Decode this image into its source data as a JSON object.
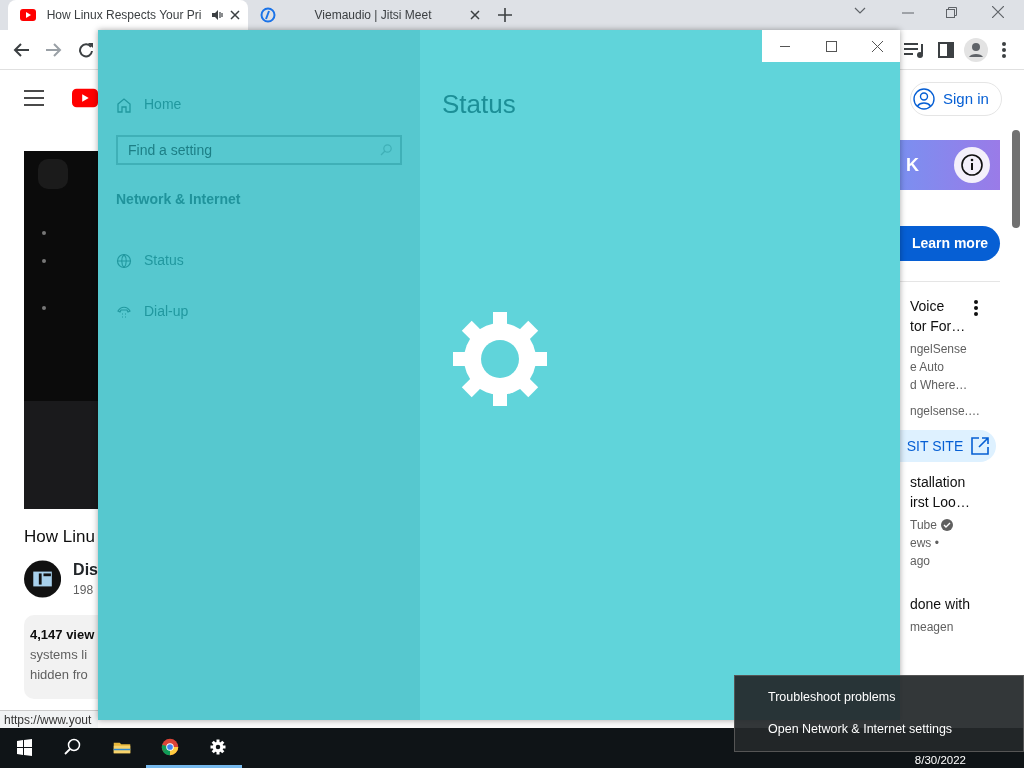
{
  "browser": {
    "tabs": [
      {
        "title": "How Linux Respects Your Pri",
        "selected": true,
        "audio": true
      },
      {
        "title": "Viemaudio | Jitsi Meet",
        "selected": false,
        "audio": false
      }
    ],
    "sign_in": "Sign in",
    "video_title": "How Linu",
    "channel_name": "Dis",
    "subscribers": "198",
    "description": [
      "4,147 view",
      "systems li",
      "hidden fro"
    ],
    "status_url": "https://www.yout",
    "ad": {
      "title": "K",
      "button": "Learn more"
    },
    "side_items": [
      {
        "title_lines": [
          "Voice",
          "tor For…"
        ],
        "meta": [
          "ngelSense",
          "e Auto",
          "d Where…"
        ],
        "link": "ngelsense.…",
        "site_button": "SIT SITE",
        "menu": true,
        "verified": false
      },
      {
        "title_lines": [
          "stallation",
          "irst Loo…"
        ],
        "meta": [
          "Tube",
          "ews •",
          "ago"
        ],
        "menu": false,
        "verified": true
      },
      {
        "title_lines": [
          "done with"
        ],
        "meta": [
          "meagen"
        ],
        "menu": false,
        "verified": false
      }
    ]
  },
  "settings": {
    "home": "Home",
    "search": {
      "placeholder": "Find a setting"
    },
    "section": "Network & Internet",
    "nav": [
      {
        "label": "Status",
        "kind": "globe"
      },
      {
        "label": "Dial-up",
        "kind": "phone"
      }
    ],
    "title": "Status"
  },
  "context_menu": {
    "items": [
      "Troubleshoot problems",
      "Open Network & Internet settings"
    ]
  },
  "taskbar": {
    "apps": [
      {
        "kind": "folder",
        "running": false
      },
      {
        "kind": "chrome",
        "running": true
      },
      {
        "kind": "settings",
        "running": true
      }
    ],
    "date": "8/30/2022"
  }
}
